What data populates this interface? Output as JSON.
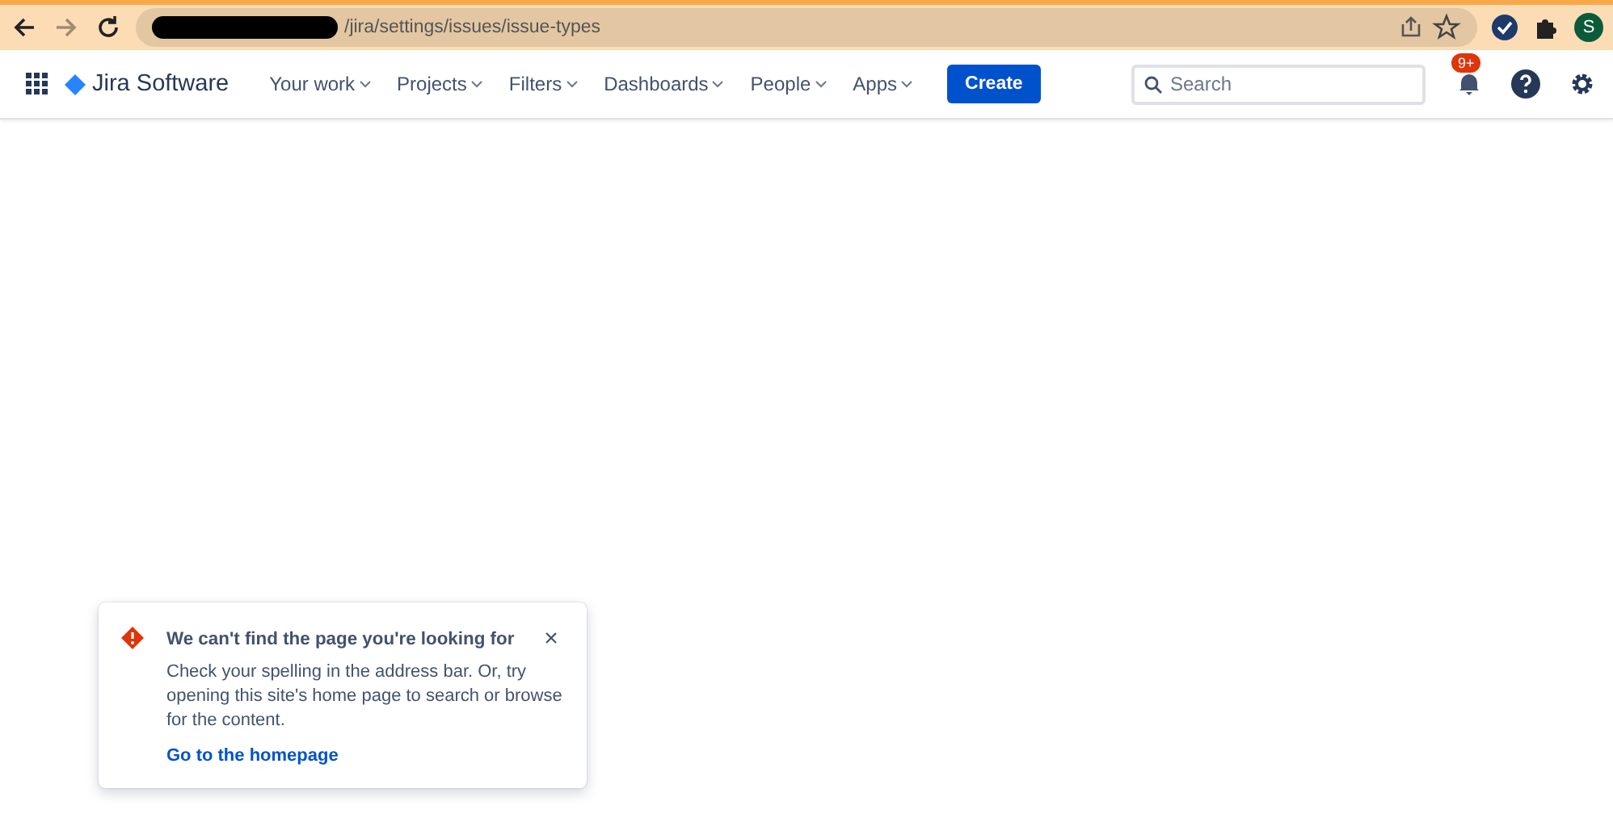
{
  "browser": {
    "url": "/jira/settings/issues/issue-types",
    "profile_initial": "S"
  },
  "nav": {
    "product": "Jira Software",
    "menus": [
      {
        "label": "Your work"
      },
      {
        "label": "Projects"
      },
      {
        "label": "Filters"
      },
      {
        "label": "Dashboards"
      },
      {
        "label": "People"
      },
      {
        "label": "Apps"
      }
    ],
    "create": "Create",
    "search": {
      "placeholder": "Search"
    },
    "notifications_badge": "9+"
  },
  "flag": {
    "title": "We can't find the page you're looking for",
    "body": "Check your spelling in the address bar. Or, try opening this site's home page to search or browse for the content.",
    "link": "Go to the homepage",
    "close": "×"
  }
}
